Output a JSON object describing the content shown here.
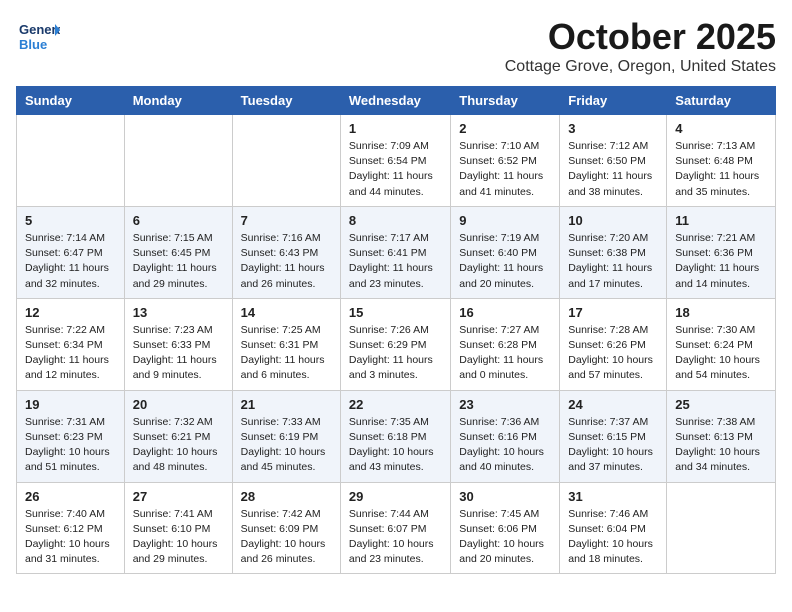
{
  "header": {
    "logo_general": "General",
    "logo_blue": "Blue",
    "month": "October 2025",
    "location": "Cottage Grove, Oregon, United States"
  },
  "weekdays": [
    "Sunday",
    "Monday",
    "Tuesday",
    "Wednesday",
    "Thursday",
    "Friday",
    "Saturday"
  ],
  "weeks": [
    [
      {
        "day": "",
        "info": ""
      },
      {
        "day": "",
        "info": ""
      },
      {
        "day": "",
        "info": ""
      },
      {
        "day": "1",
        "info": "Sunrise: 7:09 AM\nSunset: 6:54 PM\nDaylight: 11 hours\nand 44 minutes."
      },
      {
        "day": "2",
        "info": "Sunrise: 7:10 AM\nSunset: 6:52 PM\nDaylight: 11 hours\nand 41 minutes."
      },
      {
        "day": "3",
        "info": "Sunrise: 7:12 AM\nSunset: 6:50 PM\nDaylight: 11 hours\nand 38 minutes."
      },
      {
        "day": "4",
        "info": "Sunrise: 7:13 AM\nSunset: 6:48 PM\nDaylight: 11 hours\nand 35 minutes."
      }
    ],
    [
      {
        "day": "5",
        "info": "Sunrise: 7:14 AM\nSunset: 6:47 PM\nDaylight: 11 hours\nand 32 minutes."
      },
      {
        "day": "6",
        "info": "Sunrise: 7:15 AM\nSunset: 6:45 PM\nDaylight: 11 hours\nand 29 minutes."
      },
      {
        "day": "7",
        "info": "Sunrise: 7:16 AM\nSunset: 6:43 PM\nDaylight: 11 hours\nand 26 minutes."
      },
      {
        "day": "8",
        "info": "Sunrise: 7:17 AM\nSunset: 6:41 PM\nDaylight: 11 hours\nand 23 minutes."
      },
      {
        "day": "9",
        "info": "Sunrise: 7:19 AM\nSunset: 6:40 PM\nDaylight: 11 hours\nand 20 minutes."
      },
      {
        "day": "10",
        "info": "Sunrise: 7:20 AM\nSunset: 6:38 PM\nDaylight: 11 hours\nand 17 minutes."
      },
      {
        "day": "11",
        "info": "Sunrise: 7:21 AM\nSunset: 6:36 PM\nDaylight: 11 hours\nand 14 minutes."
      }
    ],
    [
      {
        "day": "12",
        "info": "Sunrise: 7:22 AM\nSunset: 6:34 PM\nDaylight: 11 hours\nand 12 minutes."
      },
      {
        "day": "13",
        "info": "Sunrise: 7:23 AM\nSunset: 6:33 PM\nDaylight: 11 hours\nand 9 minutes."
      },
      {
        "day": "14",
        "info": "Sunrise: 7:25 AM\nSunset: 6:31 PM\nDaylight: 11 hours\nand 6 minutes."
      },
      {
        "day": "15",
        "info": "Sunrise: 7:26 AM\nSunset: 6:29 PM\nDaylight: 11 hours\nand 3 minutes."
      },
      {
        "day": "16",
        "info": "Sunrise: 7:27 AM\nSunset: 6:28 PM\nDaylight: 11 hours\nand 0 minutes."
      },
      {
        "day": "17",
        "info": "Sunrise: 7:28 AM\nSunset: 6:26 PM\nDaylight: 10 hours\nand 57 minutes."
      },
      {
        "day": "18",
        "info": "Sunrise: 7:30 AM\nSunset: 6:24 PM\nDaylight: 10 hours\nand 54 minutes."
      }
    ],
    [
      {
        "day": "19",
        "info": "Sunrise: 7:31 AM\nSunset: 6:23 PM\nDaylight: 10 hours\nand 51 minutes."
      },
      {
        "day": "20",
        "info": "Sunrise: 7:32 AM\nSunset: 6:21 PM\nDaylight: 10 hours\nand 48 minutes."
      },
      {
        "day": "21",
        "info": "Sunrise: 7:33 AM\nSunset: 6:19 PM\nDaylight: 10 hours\nand 45 minutes."
      },
      {
        "day": "22",
        "info": "Sunrise: 7:35 AM\nSunset: 6:18 PM\nDaylight: 10 hours\nand 43 minutes."
      },
      {
        "day": "23",
        "info": "Sunrise: 7:36 AM\nSunset: 6:16 PM\nDaylight: 10 hours\nand 40 minutes."
      },
      {
        "day": "24",
        "info": "Sunrise: 7:37 AM\nSunset: 6:15 PM\nDaylight: 10 hours\nand 37 minutes."
      },
      {
        "day": "25",
        "info": "Sunrise: 7:38 AM\nSunset: 6:13 PM\nDaylight: 10 hours\nand 34 minutes."
      }
    ],
    [
      {
        "day": "26",
        "info": "Sunrise: 7:40 AM\nSunset: 6:12 PM\nDaylight: 10 hours\nand 31 minutes."
      },
      {
        "day": "27",
        "info": "Sunrise: 7:41 AM\nSunset: 6:10 PM\nDaylight: 10 hours\nand 29 minutes."
      },
      {
        "day": "28",
        "info": "Sunrise: 7:42 AM\nSunset: 6:09 PM\nDaylight: 10 hours\nand 26 minutes."
      },
      {
        "day": "29",
        "info": "Sunrise: 7:44 AM\nSunset: 6:07 PM\nDaylight: 10 hours\nand 23 minutes."
      },
      {
        "day": "30",
        "info": "Sunrise: 7:45 AM\nSunset: 6:06 PM\nDaylight: 10 hours\nand 20 minutes."
      },
      {
        "day": "31",
        "info": "Sunrise: 7:46 AM\nSunset: 6:04 PM\nDaylight: 10 hours\nand 18 minutes."
      },
      {
        "day": "",
        "info": ""
      }
    ]
  ]
}
